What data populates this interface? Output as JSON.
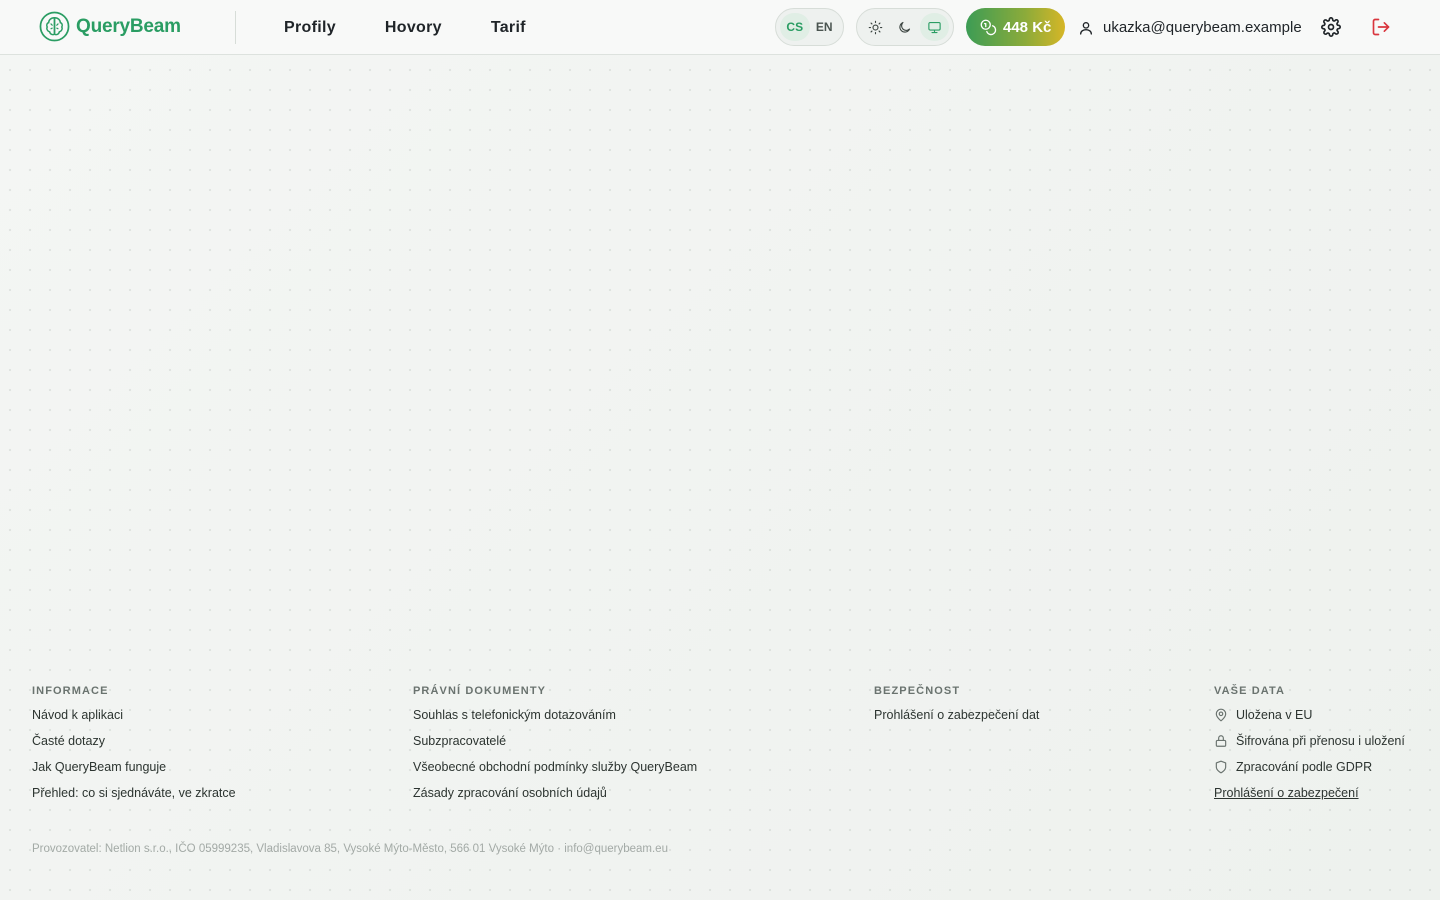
{
  "header": {
    "logo_text": "QueryBeam",
    "nav": [
      {
        "label": "Profily"
      },
      {
        "label": "Hovory"
      },
      {
        "label": "Tarif"
      }
    ],
    "languages": [
      {
        "code": "CS",
        "active": true
      },
      {
        "code": "EN",
        "active": false
      }
    ],
    "theme_options": [
      {
        "name": "sun-icon",
        "active": false
      },
      {
        "name": "moon-icon",
        "active": false
      },
      {
        "name": "monitor-icon",
        "active": true
      }
    ],
    "credit": "448 Kč",
    "user_email": "ukazka@querybeam.example"
  },
  "footer": {
    "columns": {
      "info": {
        "heading": "INFORMACE",
        "links": [
          "Návod k aplikaci",
          "Časté dotazy",
          "Jak QueryBeam funguje",
          "Přehled: co si sjednáváte, ve zkratce"
        ]
      },
      "legal": {
        "heading": "PRÁVNÍ DOKUMENTY",
        "links": [
          "Souhlas s telefonickým dotazováním",
          "Subzpracovatelé",
          "Všeobecné obchodní podmínky služby QueryBeam",
          "Zásady zpracování osobních údajů"
        ]
      },
      "security": {
        "heading": "BEZPEČNOST",
        "links": [
          "Prohlášení o zabezpečení dat"
        ]
      },
      "data": {
        "heading": "VAŠE DATA",
        "items": [
          "Uložena v EU",
          "Šifrována při přenosu i uložení",
          "Zpracování podle GDPR"
        ],
        "link": "Prohlášení o zabezpečení"
      }
    },
    "operator": "Provozovatel: Netlion s.r.o., IČO 05999235, Vladislavova 85, Vysoké Mýto-Město, 566 01 Vysoké Mýto · info@querybeam.eu"
  },
  "colors": {
    "brand": "#2a9d63",
    "logout": "#d9363e"
  }
}
